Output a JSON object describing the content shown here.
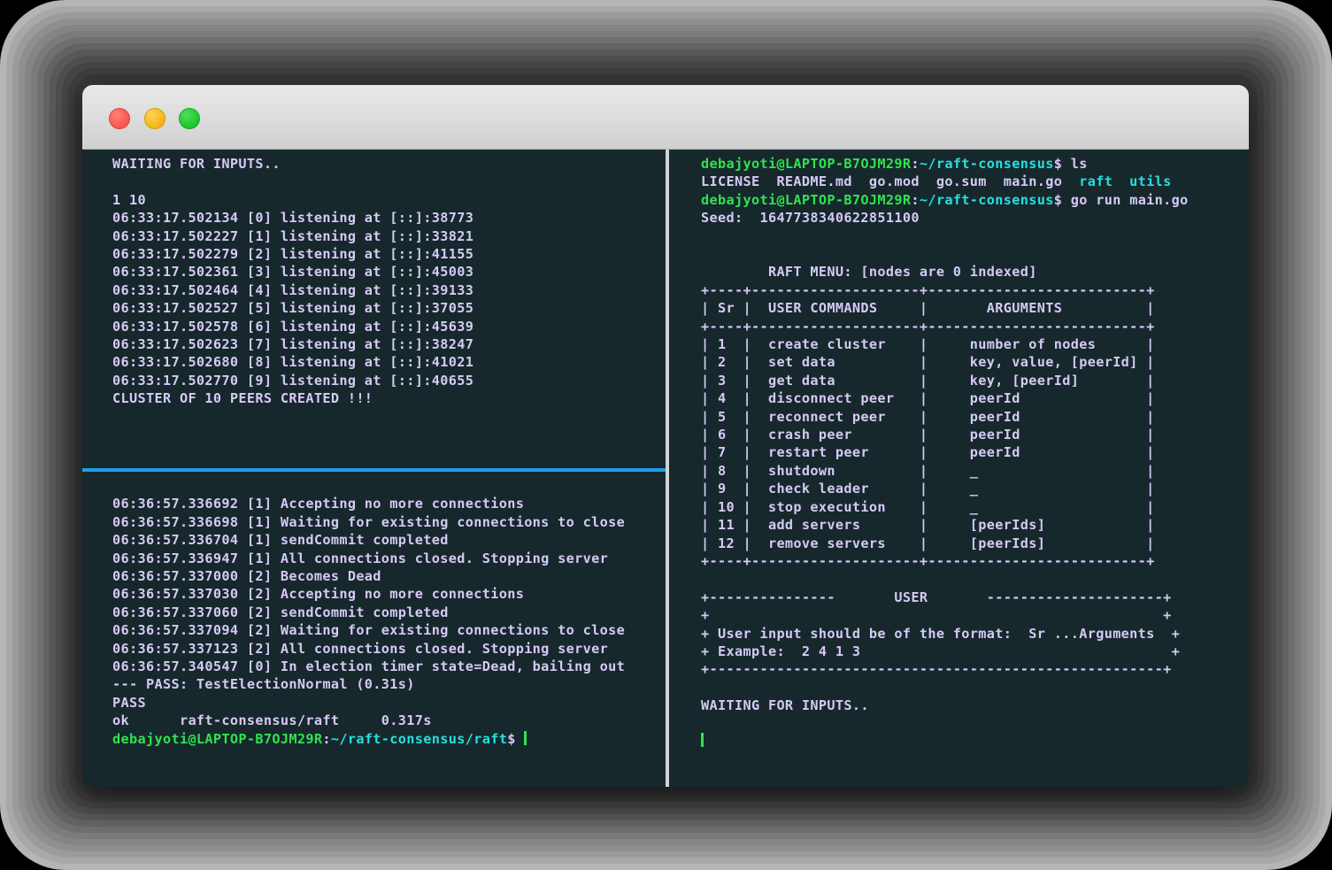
{
  "window": {
    "traffic_lights": [
      {
        "name": "close",
        "color": "#f8564c"
      },
      {
        "name": "minimize",
        "color": "#f5b416"
      },
      {
        "name": "maximize",
        "color": "#1ec42c"
      }
    ],
    "background": "#16282c",
    "divider_active_color": "#1f9fe8",
    "divider_inactive_color": "#cfd3d1"
  },
  "palette": {
    "text": "#d7c9f5",
    "green": "#2fe34f",
    "cyan": "#25e0e0"
  },
  "panes": {
    "top_left": {
      "lines": [
        "WAITING FOR INPUTS..",
        "",
        "1 10",
        "06:33:17.502134 [0] listening at [::]:38773",
        "06:33:17.502227 [1] listening at [::]:33821",
        "06:33:17.502279 [2] listening at [::]:41155",
        "06:33:17.502361 [3] listening at [::]:45003",
        "06:33:17.502464 [4] listening at [::]:39133",
        "06:33:17.502527 [5] listening at [::]:37055",
        "06:33:17.502578 [6] listening at [::]:45639",
        "06:33:17.502623 [7] listening at [::]:38247",
        "06:33:17.502680 [8] listening at [::]:41021",
        "06:33:17.502770 [9] listening at [::]:40655",
        "CLUSTER OF 10 PEERS CREATED !!!"
      ]
    },
    "bottom_left": {
      "lines": [
        "06:36:57.336692 [1] Accepting no more connections",
        "06:36:57.336698 [1] Waiting for existing connections to close",
        "06:36:57.336704 [1] sendCommit completed",
        "06:36:57.336947 [1] All connections closed. Stopping server",
        "06:36:57.337000 [2] Becomes Dead",
        "06:36:57.337030 [2] Accepting no more connections",
        "06:36:57.337060 [2] sendCommit completed",
        "06:36:57.337094 [2] Waiting for existing connections to close",
        "06:36:57.337123 [2] All connections closed. Stopping server",
        "06:36:57.340547 [0] In election timer state=Dead, bailing out",
        "--- PASS: TestElectionNormal (0.31s)",
        "PASS",
        "ok      raft-consensus/raft     0.317s"
      ],
      "prompt": {
        "user_host": "debajyoti@LAPTOP-B7OJM29R",
        "colon": ":",
        "path": "~/raft-consensus/raft",
        "sigil": "$"
      }
    },
    "right": {
      "prompt1": {
        "user_host": "debajyoti@LAPTOP-B7OJM29R",
        "colon": ":",
        "path": "~/raft-consensus",
        "sigil": "$",
        "command": " ls"
      },
      "ls_output": {
        "files": "LICENSE  README.md  go.mod  go.sum  main.go  ",
        "dirs": "raft  utils"
      },
      "prompt2": {
        "user_host": "debajyoti@LAPTOP-B7OJM29R",
        "colon": ":",
        "path": "~/raft-consensus",
        "sigil": "$",
        "command": " go run main.go"
      },
      "seed_line": "Seed:  1647738340622851100",
      "menu_title": "        RAFT MENU: [nodes are 0 indexed]",
      "menu_table": [
        "+----+--------------------+--------------------------+",
        "| Sr |  USER COMMANDS     |       ARGUMENTS          |",
        "+----+--------------------+--------------------------+",
        "| 1  |  create cluster    |     number of nodes      |",
        "| 2  |  set data          |     key, value, [peerId] |",
        "| 3  |  get data          |     key, [peerId]        |",
        "| 4  |  disconnect peer   |     peerId               |",
        "| 5  |  reconnect peer    |     peerId               |",
        "| 6  |  crash peer        |     peerId               |",
        "| 7  |  restart peer      |     peerId               |",
        "| 8  |  shutdown          |     _                    |",
        "| 9  |  check leader      |     _                    |",
        "| 10 |  stop execution    |     _                    |",
        "| 11 |  add servers       |     [peerIds]            |",
        "| 12 |  remove servers    |     [peerIds]            |",
        "+----+--------------------+--------------------------+"
      ],
      "user_box": [
        "+---------------       USER       ---------------------+",
        "+                                                      +",
        "+ User input should be of the format:  Sr ...Arguments  +",
        "+ Example:  2 4 1 3                                     +",
        "+------------------------------------------------------+"
      ],
      "waiting_line": "WAITING FOR INPUTS.."
    }
  }
}
